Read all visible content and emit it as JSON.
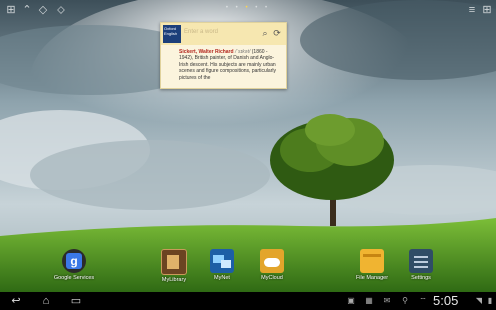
{
  "status_top": {
    "page_dots": [
      "•",
      "•",
      "•",
      "•",
      "•"
    ],
    "active_page": 2
  },
  "widget": {
    "search_placeholder": "Enter a word",
    "book_label": "Oxford English",
    "headword": "Sickert, Walter Richard",
    "grammar": "/ˈsɪkət/",
    "definition": "(1860 - 1942), British painter, of Danish and Anglo-Irish descent. His subjects are mainly urban scenes and figure compositions, particularly pictures of the"
  },
  "apps": [
    {
      "label": "Google Services",
      "icon": "google-services-icon"
    },
    {
      "label": "MyLibrary",
      "icon": "mylibrary-icon"
    },
    {
      "label": "MyNet",
      "icon": "mynet-icon"
    },
    {
      "label": "MyCloud",
      "icon": "mycloud-icon"
    },
    {
      "label": "File Manager",
      "icon": "file-manager-icon"
    },
    {
      "label": "Settings",
      "icon": "settings-icon"
    }
  ],
  "navbar": {
    "clock": "5:05"
  },
  "colors": {
    "accent_dot": "#ffd54a",
    "navbar": "#000000"
  }
}
